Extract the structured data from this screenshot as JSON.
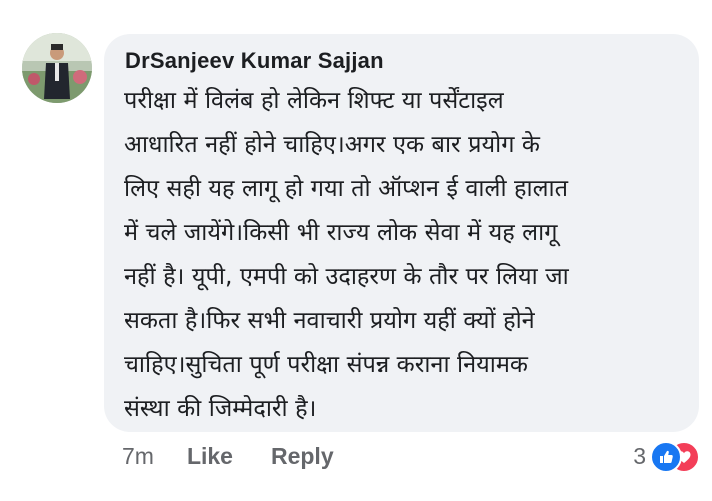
{
  "comment": {
    "author": "DrSanjeev Kumar Sajjan",
    "lines": [
      "परीक्षा में विलंब हो लेकिन शिफ्ट या पर्सेंटाइल",
      "आधारित नहीं होने चाहिए।अगर एक बार प्रयोग के",
      "लिए सही यह लागू हो गया तो ऑप्शन ई वाली हालात",
      "में चले जायेंगे।किसी भी राज्य लोक सेवा में यह लागू",
      "नहीं है। यूपी, एमपी को उदाहरण के तौर पर लिया जा",
      "सकता है।फिर सभी नवाचारी प्रयोग यहीं क्यों होने",
      "चाहिए।सुचिता पूर्ण परीक्षा संपन्न कराना नियामक",
      "संस्था की जिम्मेदारी है।"
    ]
  },
  "actions": {
    "time": "7m",
    "like_label": "Like",
    "reply_label": "Reply"
  },
  "reactions": {
    "count": "3",
    "icons": [
      "like-reaction-icon",
      "love-reaction-icon"
    ],
    "colors": {
      "like": "#1877f2",
      "love": "#f33e58"
    }
  },
  "colors": {
    "bubble": "#f0f2f5",
    "text": "#1c1e21",
    "secondary": "#65676b"
  }
}
